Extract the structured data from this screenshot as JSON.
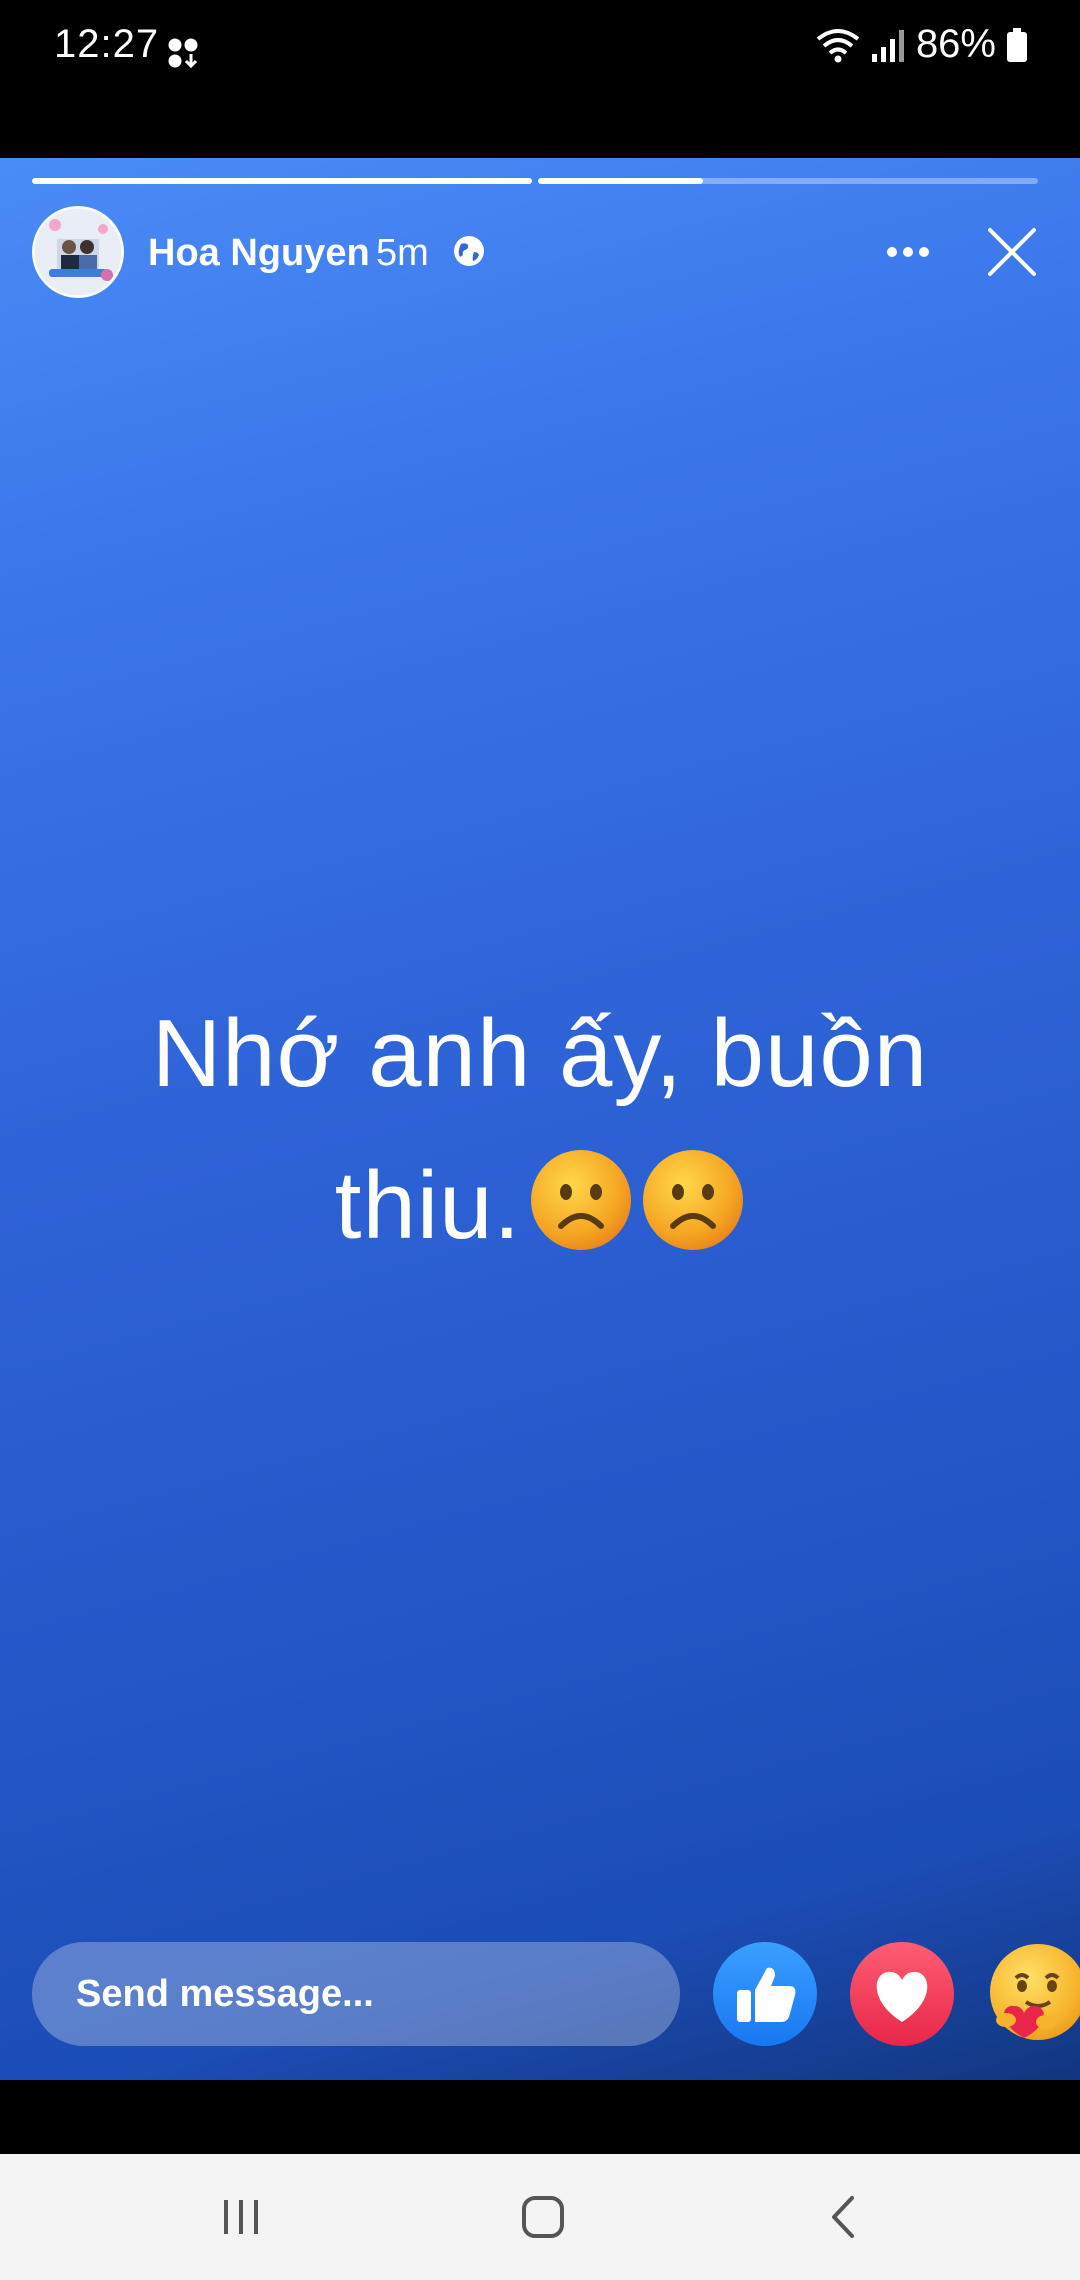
{
  "status_bar": {
    "time": "12:27",
    "battery_percent": "86%",
    "icons": [
      "notification-dots-icon",
      "wifi-icon",
      "signal-icon",
      "battery-icon"
    ]
  },
  "story": {
    "progress": {
      "segments": [
        {
          "fill": 1.0
        },
        {
          "fill": 0.33
        },
        {
          "fill": 0.0
        }
      ]
    },
    "author_name": "Hoa Nguyen",
    "time_ago": "5m",
    "privacy_icon": "globe-icon",
    "text_line1": "Nhớ anh ấy, buồn",
    "text_line2": "thiu.",
    "emoji": [
      "frowning-face-icon",
      "frowning-face-icon"
    ],
    "background_colors": [
      "#4a8cf7",
      "#2457c8",
      "#12367f"
    ]
  },
  "reply_bar": {
    "placeholder": "Send message...",
    "reactions": [
      "like-icon",
      "love-icon",
      "care-icon"
    ]
  },
  "nav_bar": {
    "buttons": [
      "recent-apps-icon",
      "home-icon",
      "back-icon"
    ]
  }
}
